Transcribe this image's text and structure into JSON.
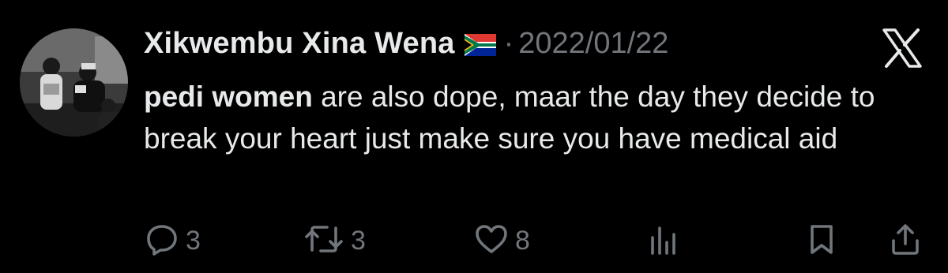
{
  "tweet": {
    "author": {
      "display_name": "Xikwembu Xina Wena",
      "flag_icon": "south-africa-flag-icon"
    },
    "separator": "·",
    "date": "2022/01/22",
    "platform_icon": "x-logo-icon",
    "text": {
      "mention": "pedi women",
      "rest": " are also dope, maar the day they decide to break your heart just make sure you have medical aid"
    },
    "actions": {
      "reply": {
        "icon": "reply-icon",
        "count": "3"
      },
      "retweet": {
        "icon": "retweet-icon",
        "count": "3"
      },
      "like": {
        "icon": "heart-icon",
        "count": "8"
      },
      "views": {
        "icon": "views-chart-icon"
      },
      "bookmark": {
        "icon": "bookmark-icon"
      },
      "share": {
        "icon": "share-icon"
      }
    }
  },
  "colors": {
    "background": "#000000",
    "primary_text": "#e7e9ea",
    "secondary_text": "#71767b"
  }
}
